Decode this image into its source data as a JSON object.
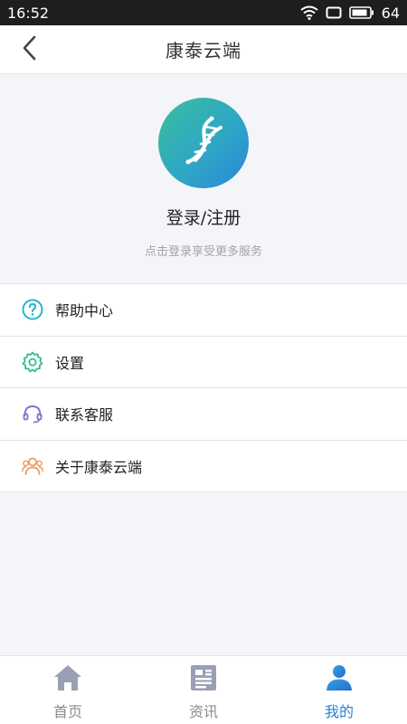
{
  "status_bar": {
    "time": "16:52",
    "battery": "64"
  },
  "header": {
    "title": "康泰云端",
    "back_icon": "chevron-left-icon"
  },
  "profile": {
    "avatar_icon": "dna-icon",
    "login_label": "登录/注册",
    "subtitle": "点击登录享受更多服务",
    "avatar_gradient": [
      "#3bbd9f",
      "#2a86d9"
    ]
  },
  "menu": {
    "items": [
      {
        "label": "帮助中心",
        "icon": "help-icon",
        "color": "#27b5c7"
      },
      {
        "label": "设置",
        "icon": "gear-icon",
        "color": "#2ebf8a"
      },
      {
        "label": "联系客服",
        "icon": "headset-icon",
        "color": "#8a6fd1"
      },
      {
        "label": "关于康泰云端",
        "icon": "people-icon",
        "color": "#f29a5b"
      }
    ]
  },
  "tabs": [
    {
      "label": "首页",
      "icon": "home-icon",
      "active": false
    },
    {
      "label": "资讯",
      "icon": "news-icon",
      "active": false
    },
    {
      "label": "我的",
      "icon": "user-icon",
      "active": true
    }
  ],
  "colors": {
    "accent": "#2b7fd6",
    "inactive": "#8a8a8f",
    "background": "#f4f5f9"
  }
}
